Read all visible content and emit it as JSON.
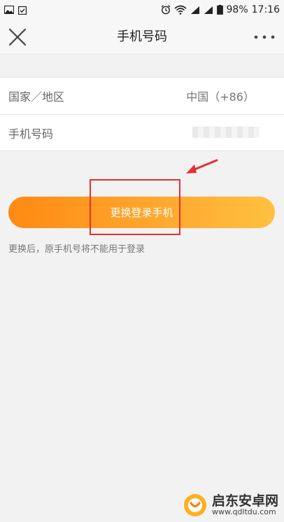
{
  "status_bar": {
    "battery_percent": "98%",
    "time": "17:16"
  },
  "nav": {
    "title": "手机号码"
  },
  "form": {
    "region_label": "国家／地区",
    "region_value": "中国（+86）",
    "phone_label": "手机号码"
  },
  "actions": {
    "change_phone_label": "更换登录手机"
  },
  "hint": "更换后，原手机号将不能用于登录",
  "watermark": {
    "title": "启东安卓网",
    "url": "www.qdltdu.com"
  },
  "colors": {
    "button_start": "#ff8a12",
    "button_end": "#ffc040",
    "annotation": "#e53030"
  }
}
